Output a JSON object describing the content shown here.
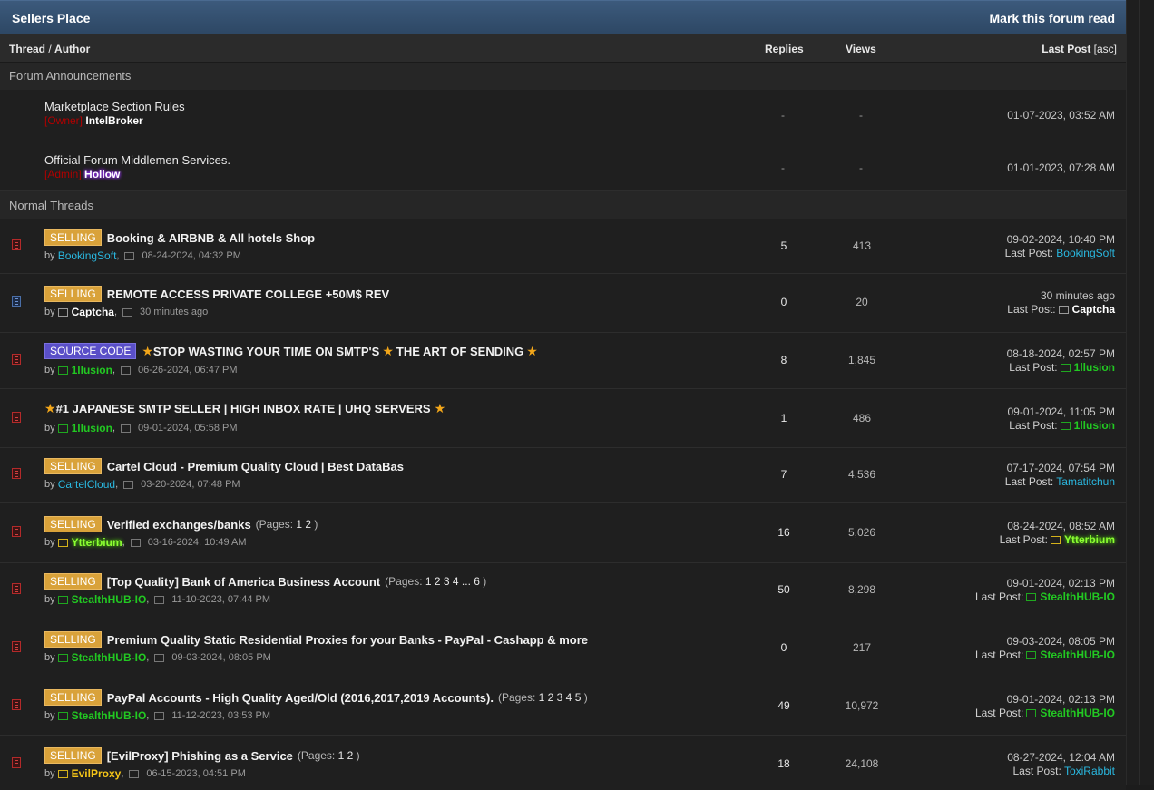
{
  "forum": {
    "title": "Sellers Place",
    "mark_read": "Mark this forum read"
  },
  "columns": {
    "thread": "Thread",
    "sep": " / ",
    "author": "Author",
    "replies": "Replies",
    "views": "Views",
    "last_post": "Last Post",
    "sort": "[asc]"
  },
  "sections": {
    "announcements": "Forum Announcements",
    "normal": "Normal Threads"
  },
  "announcements": [
    {
      "title": "Marketplace Section Rules",
      "role": "[Owner]",
      "user": "IntelBroker",
      "replies": "-",
      "views": "-",
      "last_post": "01-07-2023, 03:52 AM"
    },
    {
      "title": "Official Forum Middlemen Services.",
      "role": "[Admin]",
      "user": "Hollow",
      "replies": "-",
      "views": "-",
      "last_post": "01-01-2023, 07:28 AM"
    }
  ],
  "last_post_prefix": "Last Post:",
  "by": "by",
  "threads": [
    {
      "prefix": "SELLING",
      "title": "Booking & AIRBNB & All hotels Shop",
      "pages": "",
      "author": "BookingSoft",
      "date": "08-24-2024, 04:32 PM",
      "replies": "5",
      "views": "413",
      "lp_date": "09-02-2024, 10:40 PM",
      "lp_user": "BookingSoft"
    },
    {
      "prefix": "SELLING",
      "title": "REMOTE ACCESS PRIVATE COLLEGE +50M$ REV",
      "pages": "",
      "author": "Captcha",
      "date": "30 minutes ago",
      "replies": "0",
      "views": "20",
      "lp_date": "30 minutes ago",
      "lp_user": "Captcha"
    },
    {
      "prefix": "SOURCE CODE",
      "title": "STOP WASTING YOUR TIME ON SMTP'S",
      "title2": "THE ART OF SENDING",
      "pages": "",
      "author": "1llusion",
      "date": "06-26-2024, 06:47 PM",
      "replies": "8",
      "views": "1,845",
      "lp_date": "08-18-2024, 02:57 PM",
      "lp_user": "1llusion"
    },
    {
      "prefix": "",
      "title": "#1 JAPANESE SMTP SELLER | HIGH INBOX RATE | UHQ SERVERS",
      "pages": "",
      "author": "1llusion",
      "date": "09-01-2024, 05:58 PM",
      "replies": "1",
      "views": "486",
      "lp_date": "09-01-2024, 11:05 PM",
      "lp_user": "1llusion"
    },
    {
      "prefix": "SELLING",
      "title": "Cartel Cloud - Premium Quality Cloud | Best DataBas",
      "pages": "",
      "author": "CartelCloud",
      "date": "03-20-2024, 07:48 PM",
      "replies": "7",
      "views": "4,536",
      "lp_date": "07-17-2024, 07:54 PM",
      "lp_user": "Tamatitchun"
    },
    {
      "prefix": "SELLING",
      "title": "Verified exchanges/banks",
      "pages_label": "(Pages:",
      "pages": "1 2",
      "pages_end": ")",
      "author": "Ytterbium",
      "date": "03-16-2024, 10:49 AM",
      "replies": "16",
      "views": "5,026",
      "lp_date": "08-24-2024, 08:52 AM",
      "lp_user": "Ytterbium"
    },
    {
      "prefix": "SELLING",
      "title": "[Top Quality] Bank of America Business Account",
      "pages_label": "(Pages:",
      "pages": "1 2 3 4 ... 6",
      "pages_end": ")",
      "author": "StealthHUB-IO",
      "date": "11-10-2023, 07:44 PM",
      "replies": "50",
      "views": "8,298",
      "lp_date": "09-01-2024, 02:13 PM",
      "lp_user": "StealthHUB-IO"
    },
    {
      "prefix": "SELLING",
      "title": "Premium Quality Static Residential Proxies for your Banks - PayPal - Cashapp & more",
      "pages": "",
      "author": "StealthHUB-IO",
      "date": "09-03-2024, 08:05 PM",
      "replies": "0",
      "views": "217",
      "lp_date": "09-03-2024, 08:05 PM",
      "lp_user": "StealthHUB-IO"
    },
    {
      "prefix": "SELLING",
      "title": "PayPal Accounts - High Quality Aged/Old (2016,2017,2019 Accounts).",
      "pages_label": "(Pages:",
      "pages": "1 2 3 4 5",
      "pages_end": ")",
      "author": "StealthHUB-IO",
      "date": "11-12-2023, 03:53 PM",
      "replies": "49",
      "views": "10,972",
      "lp_date": "09-01-2024, 02:13 PM",
      "lp_user": "StealthHUB-IO"
    },
    {
      "prefix": "SELLING",
      "title": "[EvilProxy] Phishing as a Service",
      "pages_label": "(Pages:",
      "pages": "1 2",
      "pages_end": ")",
      "author": "EvilProxy",
      "date": "06-15-2023, 04:51 PM",
      "replies": "18",
      "views": "24,108",
      "lp_date": "08-27-2024, 12:04 AM",
      "lp_user": "ToxiRabbit"
    }
  ],
  "colors": {
    "accent": "#2d4764",
    "selling": "#d9a23a",
    "source_code": "#5a4fc8",
    "green_user": "#22c922",
    "cyan_user": "#2ab8e0"
  }
}
